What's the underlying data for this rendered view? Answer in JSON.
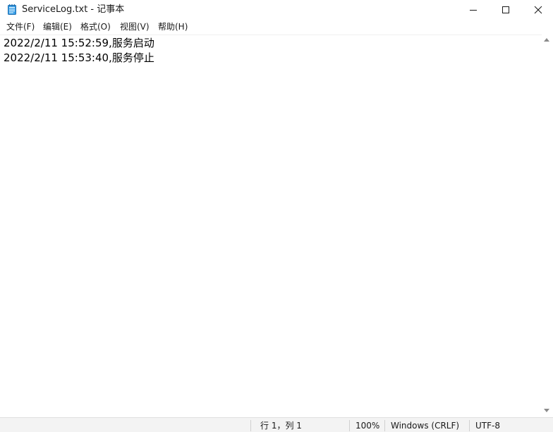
{
  "window": {
    "title": "ServiceLog.txt - 记事本",
    "app_icon": "notepad-icon",
    "controls": {
      "minimize_icon": "minimize-icon",
      "maximize_icon": "maximize-icon",
      "close_icon": "close-icon"
    }
  },
  "menubar": {
    "items": [
      {
        "label": "文件(F)"
      },
      {
        "label": "编辑(E)"
      },
      {
        "label": "格式(O)"
      },
      {
        "label": "视图(V)"
      },
      {
        "label": "帮助(H)"
      }
    ]
  },
  "editor": {
    "lines": [
      "2022/2/11 15:52:59,服务启动",
      "2022/2/11 15:53:40,服务停止"
    ]
  },
  "statusbar": {
    "position": "行 1，列 1",
    "zoom": "100%",
    "line_ending": "Windows (CRLF)",
    "encoding": "UTF-8"
  },
  "colors": {
    "background": "#ffffff",
    "statusbar_background": "#f3f3f3",
    "text": "#000000"
  }
}
